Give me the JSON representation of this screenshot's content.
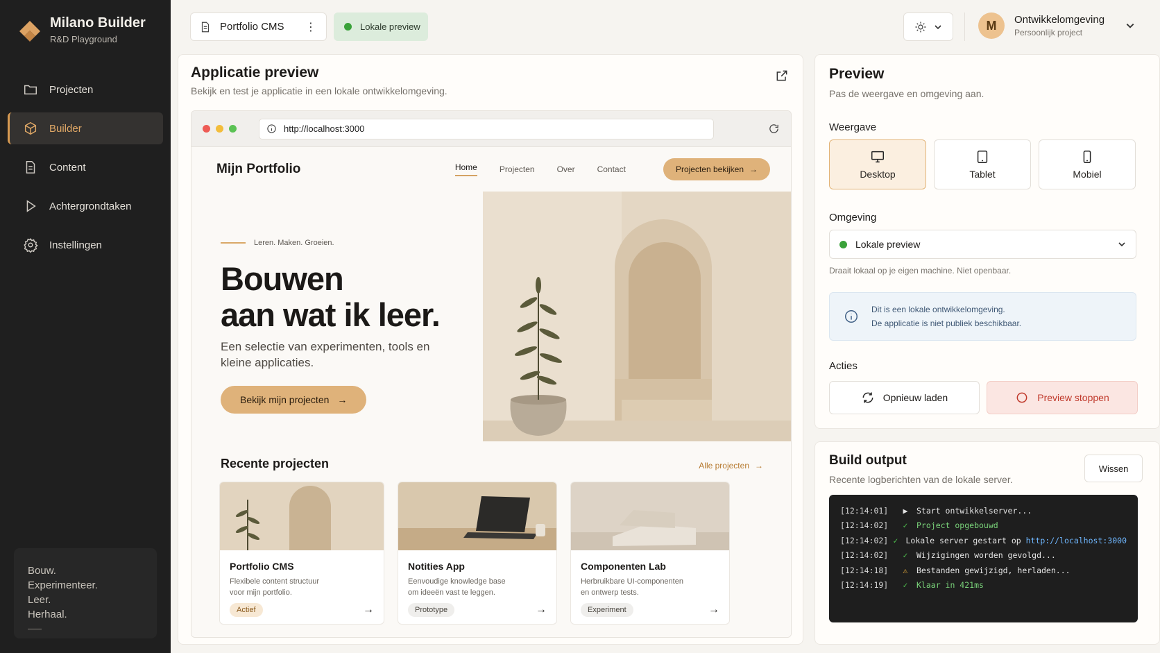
{
  "brand": {
    "title": "Milano Builder",
    "subtitle": "R&D Playground"
  },
  "sidebar": {
    "items": [
      {
        "label": "Projecten",
        "icon": "folder-icon"
      },
      {
        "label": "Builder",
        "icon": "cube-icon",
        "active": true
      },
      {
        "label": "Content",
        "icon": "document-icon"
      },
      {
        "label": "Achtergrondtaken",
        "icon": "play-icon"
      },
      {
        "label": "Instellingen",
        "icon": "gear-icon"
      }
    ],
    "motto": [
      "Bouw.",
      "Experimenteer.",
      "Leer.",
      "Herhaal."
    ]
  },
  "topbar": {
    "project": "Portfolio CMS",
    "status": "Lokale preview",
    "user_initial": "M",
    "user_name": "Ontwikkelomgeving",
    "user_sub": "Persoonlijk project"
  },
  "app_preview": {
    "title": "Applicatie preview",
    "subtitle": "Bekijk en test je applicatie in een lokale ontwikkelomgeving.",
    "url": "http://localhost:3000",
    "site": {
      "logo": "Mijn Portfolio",
      "nav": [
        "Home",
        "Projecten",
        "Over",
        "Contact"
      ],
      "cta": "Projecten bekijken",
      "eyebrow": "Leren. Maken. Groeien.",
      "hero_title_1": "Bouwen",
      "hero_title_2": "aan wat ik leer.",
      "hero_sub": "Een selectie van experimenten, tools en kleine applicaties.",
      "hero_btn": "Bekijk mijn projecten",
      "recent_title": "Recente projecten",
      "recent_all": "Alle projecten",
      "projects": [
        {
          "name": "Portfolio CMS",
          "desc_1": "Flexibele content structuur",
          "desc_2": "voor mijn portfolio.",
          "tag": "Actief"
        },
        {
          "name": "Notities App",
          "desc_1": "Eenvoudige knowledge base",
          "desc_2": "om ideeën vast te leggen.",
          "tag": "Prototype"
        },
        {
          "name": "Componenten Lab",
          "desc_1": "Herbruikbare UI-componenten",
          "desc_2": "en ontwerp tests.",
          "tag": "Experiment"
        }
      ]
    }
  },
  "preview_panel": {
    "title": "Preview",
    "subtitle": "Pas de weergave en omgeving aan.",
    "view_label": "Weergave",
    "views": [
      "Desktop",
      "Tablet",
      "Mobiel"
    ],
    "env_label": "Omgeving",
    "env_value": "Lokale preview",
    "env_note": "Draait lokaal op je eigen machine. Niet openbaar.",
    "info_1": "Dit is een lokale ontwikkelomgeving.",
    "info_2": "De applicatie is niet publiek beschikbaar.",
    "actions_label": "Acties",
    "reload": "Opnieuw laden",
    "stop": "Preview stoppen"
  },
  "build": {
    "title": "Build output",
    "subtitle": "Recente logberichten van de lokale server.",
    "clear": "Wissen",
    "logs": [
      {
        "ts": "[12:14:01]",
        "icon": "play",
        "msg": "Start ontwikkelserver...",
        "url": ""
      },
      {
        "ts": "[12:14:02]",
        "icon": "check",
        "msg": "Project opgebouwd",
        "url": ""
      },
      {
        "ts": "[12:14:02]",
        "icon": "check",
        "msg": "Lokale server gestart op ",
        "url": "http://localhost:3000"
      },
      {
        "ts": "[12:14:02]",
        "icon": "check",
        "msg": "Wijzigingen worden gevolgd...",
        "url": ""
      },
      {
        "ts": "[12:14:18]",
        "icon": "warning",
        "msg": "Bestanden gewijzigd, herladen...",
        "url": ""
      },
      {
        "ts": "[12:14:19]",
        "icon": "check",
        "msg": "Klaar in 421ms",
        "url": ""
      }
    ]
  },
  "colors": {
    "accent": "#dfb27a",
    "sidebar": "#1f1f1f",
    "success": "#3aa23a",
    "danger": "#c0392b"
  }
}
